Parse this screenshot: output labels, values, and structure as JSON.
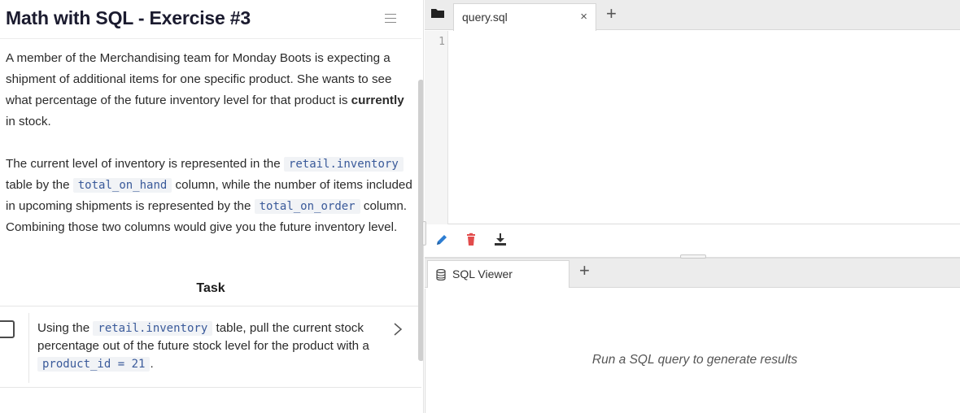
{
  "left_panel": {
    "title": "Math with SQL - Exercise #3",
    "paragraph1": {
      "prefix": "A member of the Merchandising team for Monday Boots is expecting a shipment of additional items for one specific product. She wants to see what percentage of the future inventory level for that product is ",
      "bold": "currently",
      "suffix": " in stock."
    },
    "paragraph2": {
      "t1": "The current level of inventory is represented in the ",
      "c1": "retail.inventory",
      "t2": " table by the ",
      "c2": "total_on_hand",
      "t3": " column, while the number of items included in upcoming shipments is represented by the ",
      "c3": "total_on_order",
      "t4": " column. Combining those two columns would give you the future inventory level."
    },
    "task_heading": "Task",
    "task": {
      "t1": "Using the ",
      "c1": "retail.inventory",
      "t2": " table, pull the current stock percentage out of the future stock level for the product with a ",
      "c2": "product_id = 21",
      "t3": "."
    }
  },
  "editor": {
    "tab_label": "query.sql",
    "tab_close": "×",
    "add_tab": "+",
    "line_number": "1",
    "toolbar_icons": [
      "pencil-icon",
      "trash-icon",
      "download-icon"
    ]
  },
  "viewer": {
    "tab_label": "SQL Viewer",
    "add_tab": "+",
    "empty_message": "Run a SQL query to generate results"
  },
  "colors": {
    "accent_blue": "#2d7dd2",
    "delete_red": "#e24c4c",
    "code_text": "#3a5a9a"
  }
}
